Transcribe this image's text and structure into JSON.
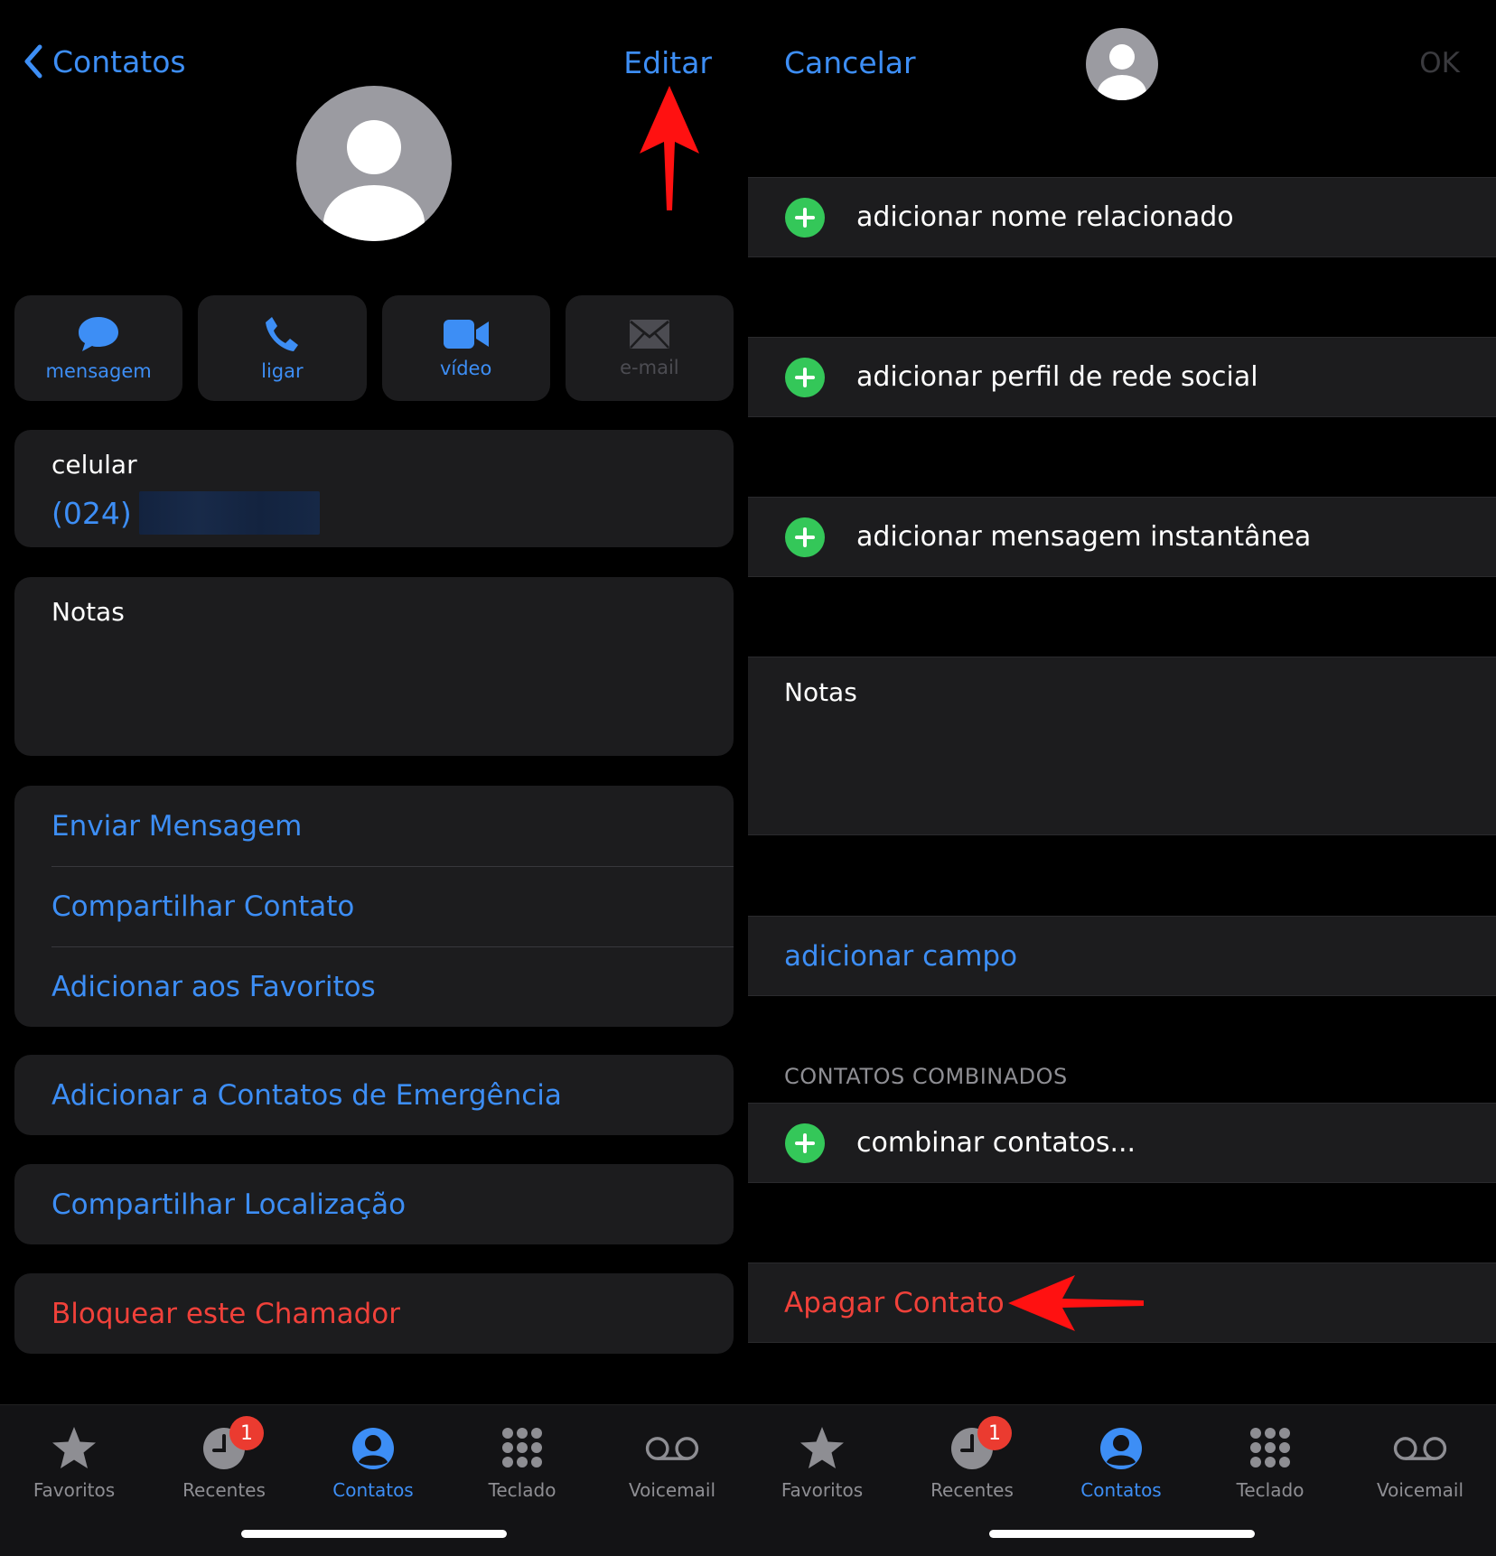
{
  "left": {
    "nav": {
      "back_label": "Contatos",
      "edit_label": "Editar"
    },
    "actions": [
      {
        "label": "mensagem",
        "icon": "message-bubble-icon"
      },
      {
        "label": "ligar",
        "icon": "phone-icon"
      },
      {
        "label": "vídeo",
        "icon": "video-camera-icon"
      },
      {
        "label": "e-mail",
        "icon": "envelope-icon"
      }
    ],
    "phone": {
      "label": "celular",
      "value_prefix": "(024)"
    },
    "notes": {
      "label": "Notas"
    },
    "options": {
      "send_message": "Enviar Mensagem",
      "share_contact": "Compartilhar Contato",
      "add_favorites": "Adicionar aos Favoritos",
      "add_emergency": "Adicionar a Contatos de Emergência",
      "share_location": "Compartilhar Localização",
      "block_caller": "Bloquear este Chamador"
    }
  },
  "right": {
    "nav": {
      "cancel_label": "Cancelar",
      "ok_label": "OK"
    },
    "rows": {
      "related_name": "adicionar nome relacionado",
      "social_profile": "adicionar perfil de rede social",
      "instant_message": "adicionar mensagem instantânea",
      "notes": "Notas",
      "add_field": "adicionar campo",
      "linked_header": "CONTATOS COMBINADOS",
      "link_contacts": "combinar contatos...",
      "delete_contact": "Apagar Contato"
    }
  },
  "tabbar": {
    "tabs": [
      {
        "label": "Favoritos",
        "icon": "star-icon"
      },
      {
        "label": "Recentes",
        "icon": "clock-icon",
        "badge": "1"
      },
      {
        "label": "Contatos",
        "icon": "person-circle-icon",
        "active": true
      },
      {
        "label": "Teclado",
        "icon": "keypad-icon"
      },
      {
        "label": "Voicemail",
        "icon": "voicemail-icon"
      }
    ]
  },
  "colors": {
    "accent_blue": "#3d8ef5",
    "destructive_red": "#f0413a",
    "add_green": "#34c759",
    "badge_red": "#eb3b30",
    "annotation_arrow": "#ff1111",
    "card_bg": "#1c1c1e"
  }
}
